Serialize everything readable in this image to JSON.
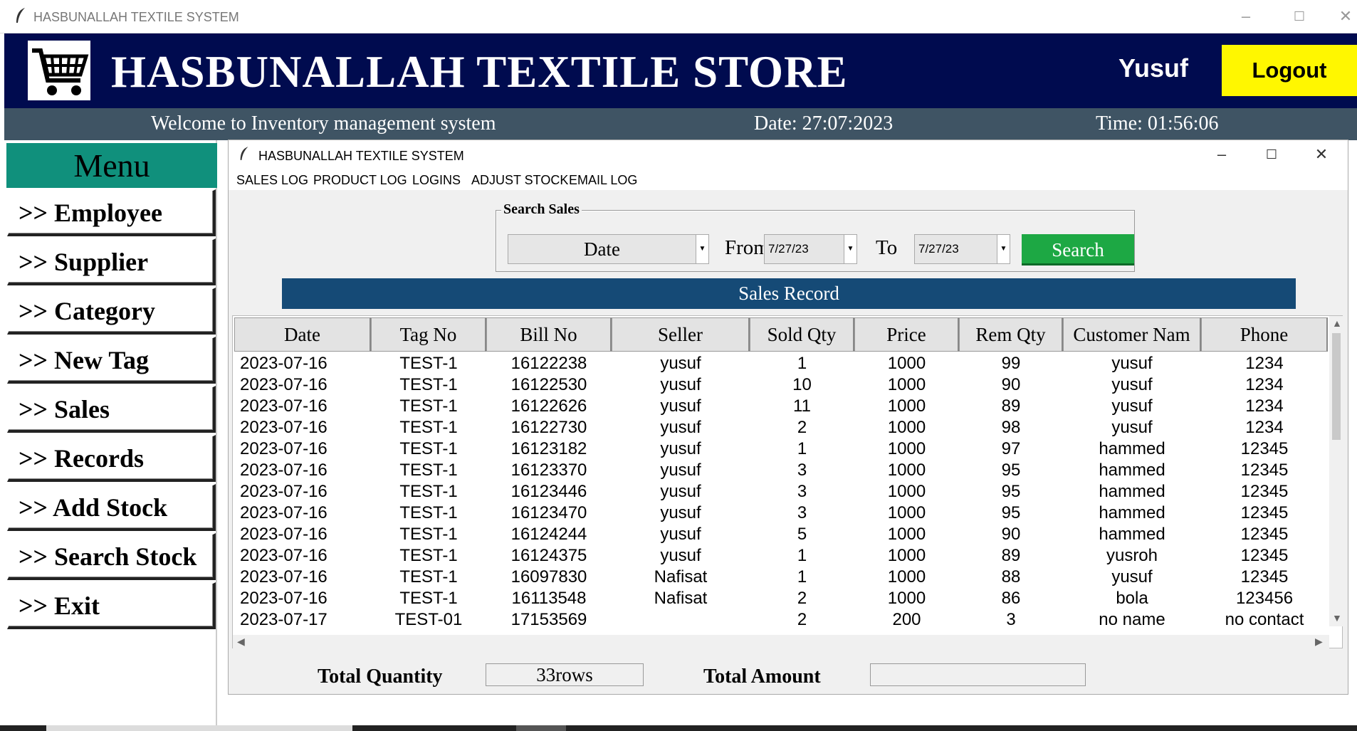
{
  "window": {
    "title": "HASBUNALLAH TEXTILE SYSTEM"
  },
  "header": {
    "store_name": "HASBUNALLAH TEXTILE STORE",
    "user": "Yusuf",
    "logout_label": "Logout"
  },
  "infobar": {
    "welcome": "Welcome to Inventory management system",
    "date": "Date: 27:07:2023",
    "time": "Time: 01:56:06"
  },
  "sidebar": {
    "title": "Menu",
    "items": [
      ">> Employee",
      ">> Supplier",
      ">> Category",
      ">> New Tag",
      ">> Sales",
      ">> Records",
      ">> Add Stock",
      ">> Search Stock",
      ">> Exit"
    ]
  },
  "child_window": {
    "title": "HASBUNALLAH TEXTILE SYSTEM",
    "menus": [
      "SALES LOG",
      "PRODUCT LOG",
      "LOGINS",
      "ADJUST STOCK",
      "EMAIL LOG"
    ]
  },
  "search": {
    "legend": "Search Sales",
    "field": "Date",
    "from_label": "From",
    "from_value": "7/27/23",
    "to_label": "To",
    "to_value": "7/27/23",
    "button": "Search"
  },
  "banner": "Sales Record",
  "table": {
    "columns": [
      "Date",
      "Tag No",
      "Bill No",
      "Seller",
      "Sold Qty",
      "Price",
      "Rem Qty",
      "Customer Nam",
      "Phone"
    ],
    "rows": [
      [
        "2023-07-16",
        "TEST-1",
        "16122238",
        "yusuf",
        "1",
        "1000",
        "99",
        "yusuf",
        "1234"
      ],
      [
        "2023-07-16",
        "TEST-1",
        "16122530",
        "yusuf",
        "10",
        "1000",
        "90",
        "yusuf",
        "1234"
      ],
      [
        "2023-07-16",
        "TEST-1",
        "16122626",
        "yusuf",
        "11",
        "1000",
        "89",
        "yusuf",
        "1234"
      ],
      [
        "2023-07-16",
        "TEST-1",
        "16122730",
        "yusuf",
        "2",
        "1000",
        "98",
        "yusuf",
        "1234"
      ],
      [
        "2023-07-16",
        "TEST-1",
        "16123182",
        "yusuf",
        "1",
        "1000",
        "97",
        "hammed",
        "12345"
      ],
      [
        "2023-07-16",
        "TEST-1",
        "16123370",
        "yusuf",
        "3",
        "1000",
        "95",
        "hammed",
        "12345"
      ],
      [
        "2023-07-16",
        "TEST-1",
        "16123446",
        "yusuf",
        "3",
        "1000",
        "95",
        "hammed",
        "12345"
      ],
      [
        "2023-07-16",
        "TEST-1",
        "16123470",
        "yusuf",
        "3",
        "1000",
        "95",
        "hammed",
        "12345"
      ],
      [
        "2023-07-16",
        "TEST-1",
        "16124244",
        "yusuf",
        "5",
        "1000",
        "90",
        "hammed",
        "12345"
      ],
      [
        "2023-07-16",
        "TEST-1",
        "16124375",
        "yusuf",
        "1",
        "1000",
        "89",
        "yusroh",
        "12345"
      ],
      [
        "2023-07-16",
        "TEST-1",
        "16097830",
        "Nafisat",
        "1",
        "1000",
        "88",
        "yusuf",
        "12345"
      ],
      [
        "2023-07-16",
        "TEST-1",
        "16113548",
        "Nafisat",
        "2",
        "1000",
        "86",
        "bola",
        "123456"
      ],
      [
        "2023-07-17",
        "TEST-01",
        "17153569",
        "",
        "2",
        "200",
        "3",
        "no name",
        "no contact"
      ]
    ]
  },
  "footer": {
    "total_qty_label": "Total Quantity",
    "total_qty_value": "33rows",
    "total_amount_label": "Total Amount",
    "total_amount_value": ""
  },
  "colors": {
    "header_bg": "#000b4f",
    "infobar_bg": "#3f5464",
    "menu_head_bg": "#10907c",
    "logout_bg": "#fff700",
    "search_btn": "#1da844",
    "banner_bg": "#154a76"
  }
}
